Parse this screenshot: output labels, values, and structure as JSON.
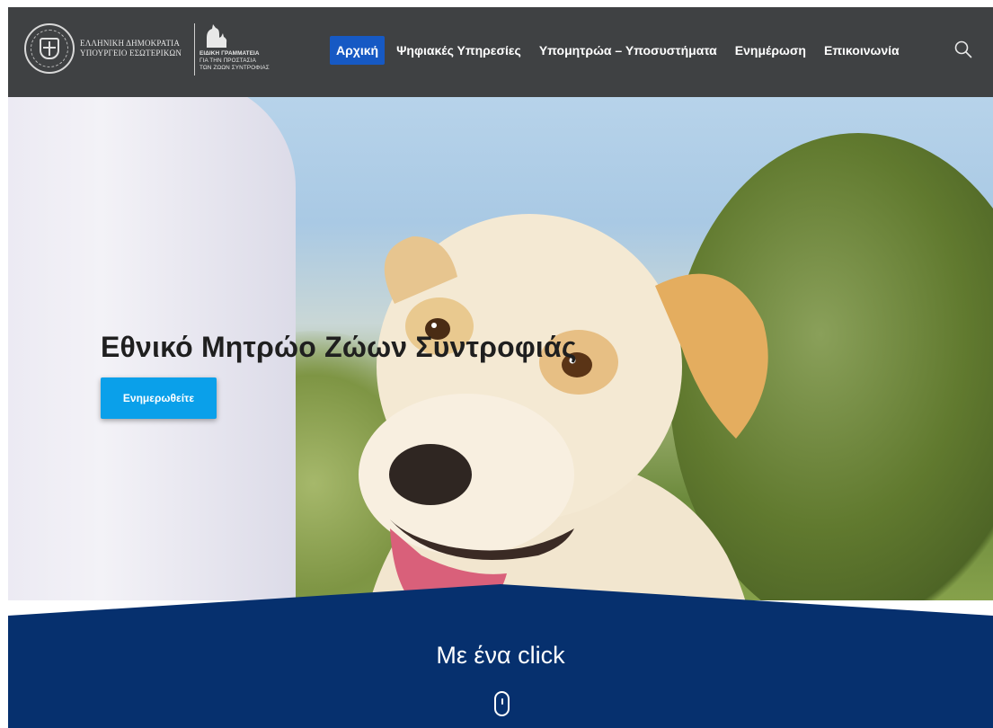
{
  "header": {
    "gov_logo_line1": "ΕΛΛΗΝΙΚΗ ΔΗΜΟΚΡΑΤΙΑ",
    "gov_logo_line2": "ΥΠΟΥΡΓΕΙΟ ΕΣΩΤΕΡΙΚΩΝ",
    "secretariat_line1": "ΕΙΔΙΚΗ ΓΡΑΜΜΑΤΕΙΑ",
    "secretariat_line2": "ΓΙΑ ΤΗΝ ΠΡΟΣΤΑΣΙΑ",
    "secretariat_line3": "ΤΩΝ ΖΩΩΝ ΣΥΝΤΡΟΦΙΑΣ",
    "nav": [
      {
        "label": "Αρχική",
        "active": true
      },
      {
        "label": "Ψηφιακές Υπηρεσίες",
        "active": false
      },
      {
        "label": "Υπομητρώα – Υποσυστήματα",
        "active": false
      },
      {
        "label": "Ενημέρωση",
        "active": false
      },
      {
        "label": "Επικοινωνία",
        "active": false
      }
    ],
    "search_icon": "search-icon",
    "bg_color": "#3f4143",
    "active_color": "#1659c4"
  },
  "hero": {
    "title": "Εθνικό Μητρώο Ζώων Συντροφιάς",
    "button_label": "Ενημερωθείτε",
    "button_color": "#0aa0ea"
  },
  "band": {
    "title": "Με ένα click",
    "scroll_icon": "mouse-scroll-icon",
    "bg_color": "#06306e"
  }
}
